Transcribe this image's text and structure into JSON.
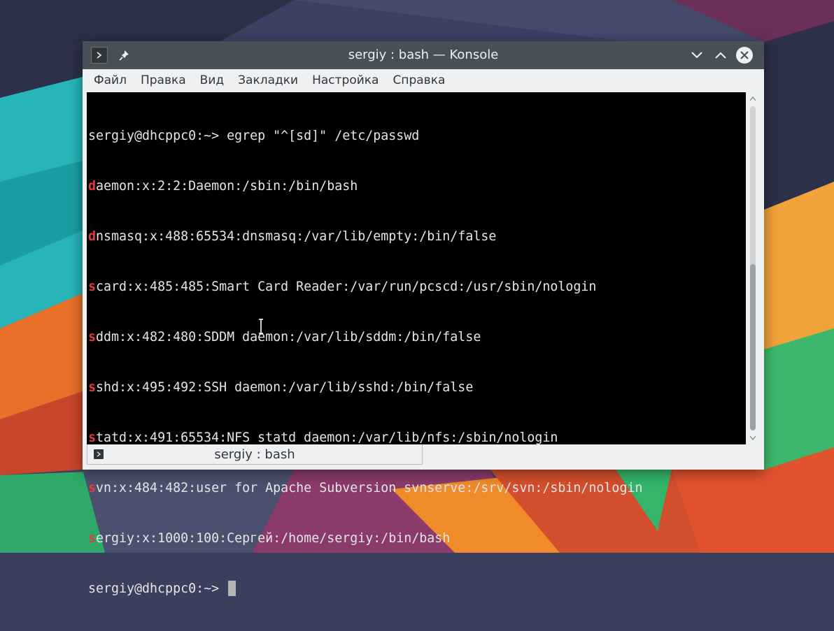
{
  "window": {
    "title": "sergiy : bash — Konsole"
  },
  "menu": [
    "Файл",
    "Правка",
    "Вид",
    "Закладки",
    "Настройка",
    "Справка"
  ],
  "terminal": {
    "lines": [
      {
        "hl": "",
        "rest": "sergiy@dhcppc0:~> egrep \"^[sd]\" /etc/passwd"
      },
      {
        "hl": "d",
        "rest": "aemon:x:2:2:Daemon:/sbin:/bin/bash"
      },
      {
        "hl": "d",
        "rest": "nsmasq:x:488:65534:dnsmasq:/var/lib/empty:/bin/false"
      },
      {
        "hl": "s",
        "rest": "card:x:485:485:Smart Card Reader:/var/run/pcscd:/usr/sbin/nologin"
      },
      {
        "hl": "s",
        "rest": "ddm:x:482:480:SDDM daemon:/var/lib/sddm:/bin/false"
      },
      {
        "hl": "s",
        "rest": "shd:x:495:492:SSH daemon:/var/lib/sshd:/bin/false"
      },
      {
        "hl": "s",
        "rest": "tatd:x:491:65534:NFS statd daemon:/var/lib/nfs:/sbin/nologin"
      },
      {
        "hl": "s",
        "rest": "vn:x:484:482:user for Apache Subversion svnserve:/srv/svn:/sbin/nologin"
      },
      {
        "hl": "s",
        "rest": "ergiy:x:1000:100:Сергей:/home/sergiy:/bin/bash"
      },
      {
        "hl": "",
        "rest": "sergiy@dhcppc0:~> "
      }
    ]
  },
  "tab": {
    "label": "sergiy : bash"
  },
  "icons": {
    "app": "terminal-icon",
    "pin": "pin-icon",
    "minimize": "chevron-down-icon",
    "maximize": "chevron-up-icon",
    "close": "close-icon"
  },
  "colors": {
    "titlebar": "#475057",
    "terminal_bg": "#000000",
    "terminal_fg": "#e6e6e6",
    "match_highlight": "#e33b3b"
  }
}
